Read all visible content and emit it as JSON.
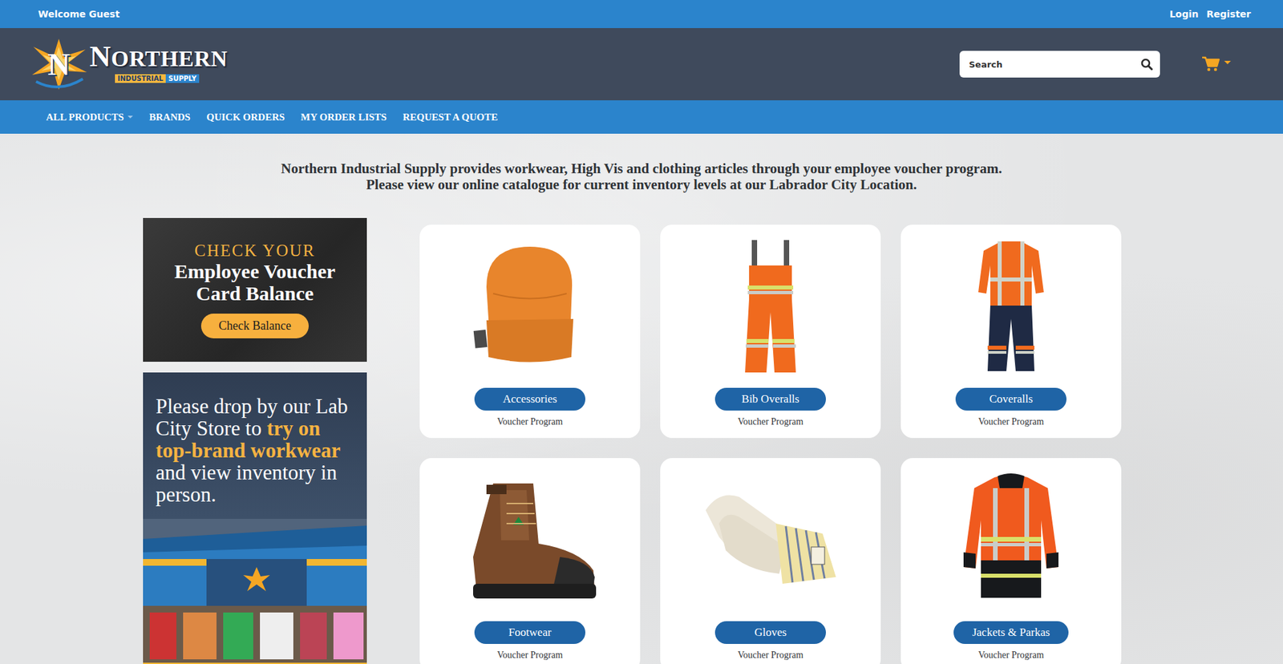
{
  "topbar": {
    "welcome": "Welcome Guest",
    "links": [
      "Login",
      "Register"
    ]
  },
  "header": {
    "logo": {
      "mark": "N",
      "name": "NORTHERN",
      "tag": [
        "INDUSTRIAL",
        "SUPPLY"
      ]
    },
    "search": {
      "placeholder": "Search"
    }
  },
  "nav": [
    {
      "label": "ALL PRODUCTS",
      "has_menu": true
    },
    {
      "label": "BRANDS",
      "has_menu": false
    },
    {
      "label": "QUICK ORDERS",
      "has_menu": false
    },
    {
      "label": "MY ORDER LISTS",
      "has_menu": false
    },
    {
      "label": "REQUEST A QUOTE",
      "has_menu": false
    }
  ],
  "intro": [
    "Northern Industrial Supply provides workwear, High Vis and clothing articles through your employee voucher program.",
    "Please view our online catalogue for current inventory levels at our Labrador City Location."
  ],
  "promos": {
    "balance": {
      "kicker": "CHECK YOUR",
      "title": [
        "Employee Voucher",
        "Card Balance"
      ],
      "button": "Check Balance"
    },
    "store": {
      "segments": [
        {
          "text": "Please drop by our Lab City Store to ",
          "highlight": false
        },
        {
          "text": "try on top-brand workwear",
          "highlight": true
        },
        {
          "text": " and view inventory in person.",
          "highlight": false
        }
      ]
    }
  },
  "categories": [
    {
      "name": "Accessories",
      "program": "Voucher Program"
    },
    {
      "name": "Bib Overalls",
      "program": "Voucher Program"
    },
    {
      "name": "Coveralls",
      "program": "Voucher Program"
    },
    {
      "name": "Footwear",
      "program": "Voucher Program"
    },
    {
      "name": "Gloves",
      "program": "Voucher Program"
    },
    {
      "name": "Jackets & Parkas",
      "program": "Voucher Program"
    }
  ]
}
